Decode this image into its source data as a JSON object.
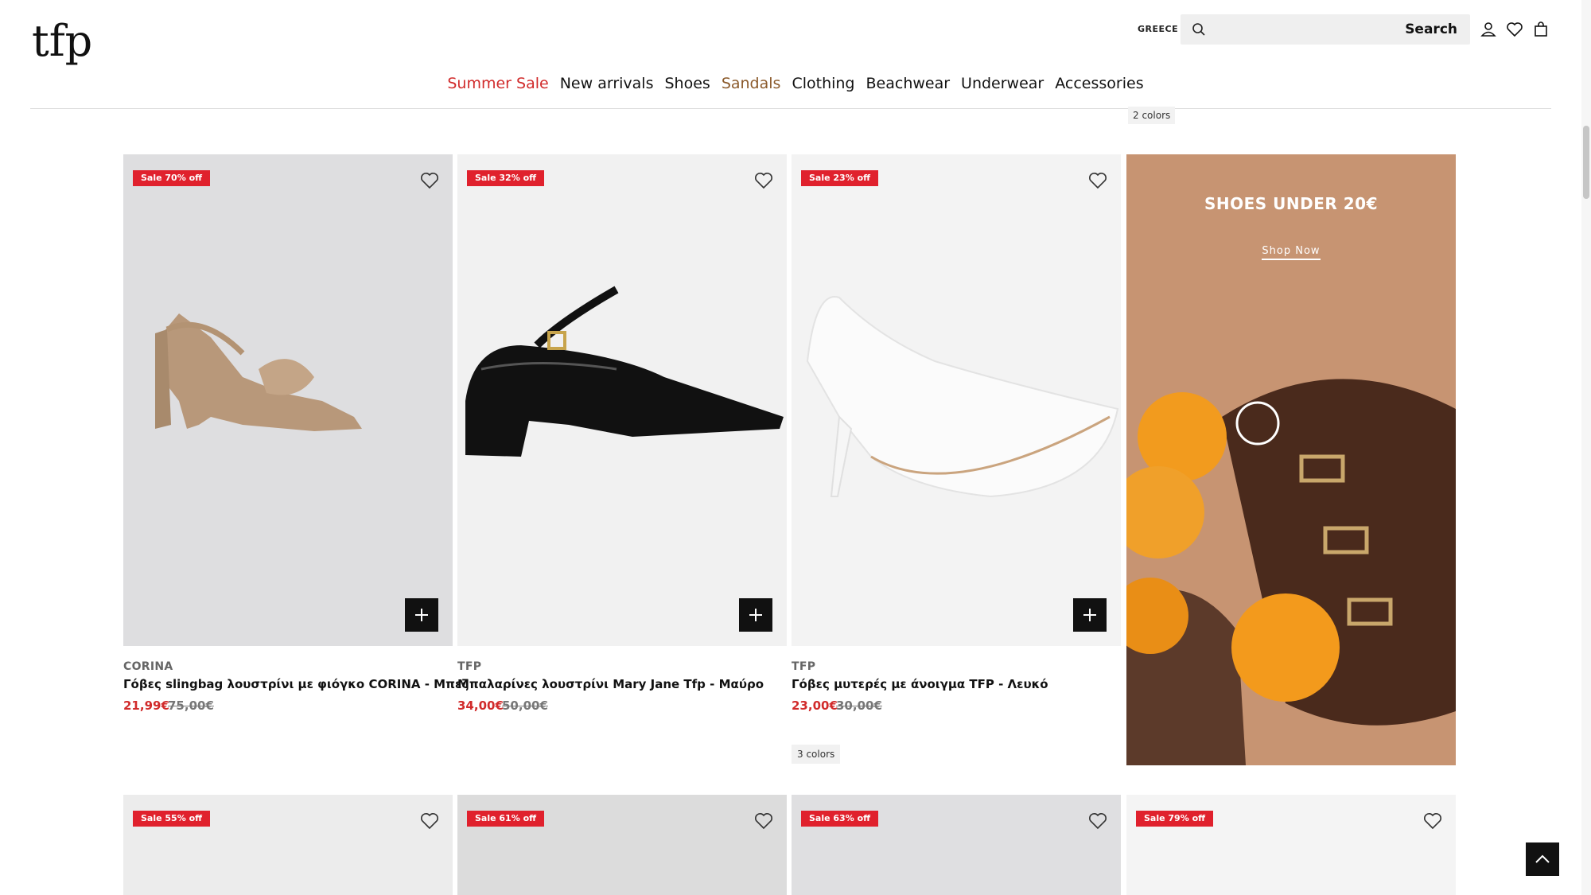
{
  "header": {
    "logo_text": "tfp",
    "region": "GREECE",
    "search": {
      "placeholder": "",
      "label": "Search"
    },
    "nav": [
      "Summer Sale",
      "New arrivals",
      "Shoes",
      "Sandals",
      "Clothing",
      "Beachwear",
      "Underwear",
      "Accessories"
    ]
  },
  "colors": {
    "sale_red": "#e0212d",
    "nav_sale": "#d12b2b",
    "nav_sandals": "#8b5a2b",
    "promo_bg": "#c79472"
  },
  "top_colors_chip": "2 colors",
  "products": [
    {
      "badge": "Sale 70% off",
      "brand": "CORINA",
      "name": "Γόβες slingbag λουστρίνι με φιόγκο CORINA - Μπεζ",
      "price": "21,99€",
      "old_price": "75,00€"
    },
    {
      "badge": "Sale 32% off",
      "brand": "TFP",
      "name": "Μπαλαρίνες λουστρίνι Mary Jane Tfp - Μαύρο",
      "price": "34,00€",
      "old_price": "50,00€"
    },
    {
      "badge": "Sale 23% off",
      "brand": "TFP",
      "name": "Γόβες μυτερές με άνοιγμα TFP - Λευκό",
      "price": "23,00€",
      "old_price": "30,00€",
      "colors": "3 colors"
    }
  ],
  "promo": {
    "title": "SHOES UNDER 20€",
    "link": "Shop Now"
  },
  "next_row_badges": [
    "Sale 55% off",
    "Sale 61% off",
    "Sale 63% off",
    "Sale 79% off"
  ]
}
